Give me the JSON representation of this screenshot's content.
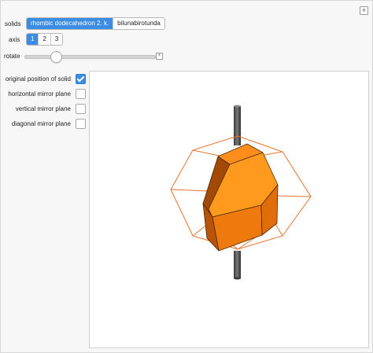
{
  "controls": {
    "solids": {
      "label": "solids",
      "options": [
        "rhombic dodecahedron 2. k.",
        "bilunabirotunda"
      ],
      "selected": 0
    },
    "axis": {
      "label": "axis",
      "options": [
        "1",
        "2",
        "3"
      ],
      "selected": 0
    },
    "rotate": {
      "label": "rotate",
      "value_fraction": 0.25
    },
    "checkboxes": [
      {
        "label": "original position of solid",
        "checked": true
      },
      {
        "label": "horizontal mirror plane",
        "checked": false
      },
      {
        "label": "vertical mirror plane",
        "checked": false
      },
      {
        "label": "diagonal mirror plane",
        "checked": false
      }
    ]
  },
  "colors": {
    "accent": "#3b8de4",
    "solid_light": "#ff9a1f",
    "solid_mid": "#f08010",
    "solid_dark": "#c95a08",
    "wireframe": "#e8722a",
    "axis_rod": "#555555"
  },
  "icons": {
    "panel_plus": "plus-icon",
    "slider_plus": "plus-icon",
    "checkmark": "checkmark-icon"
  }
}
